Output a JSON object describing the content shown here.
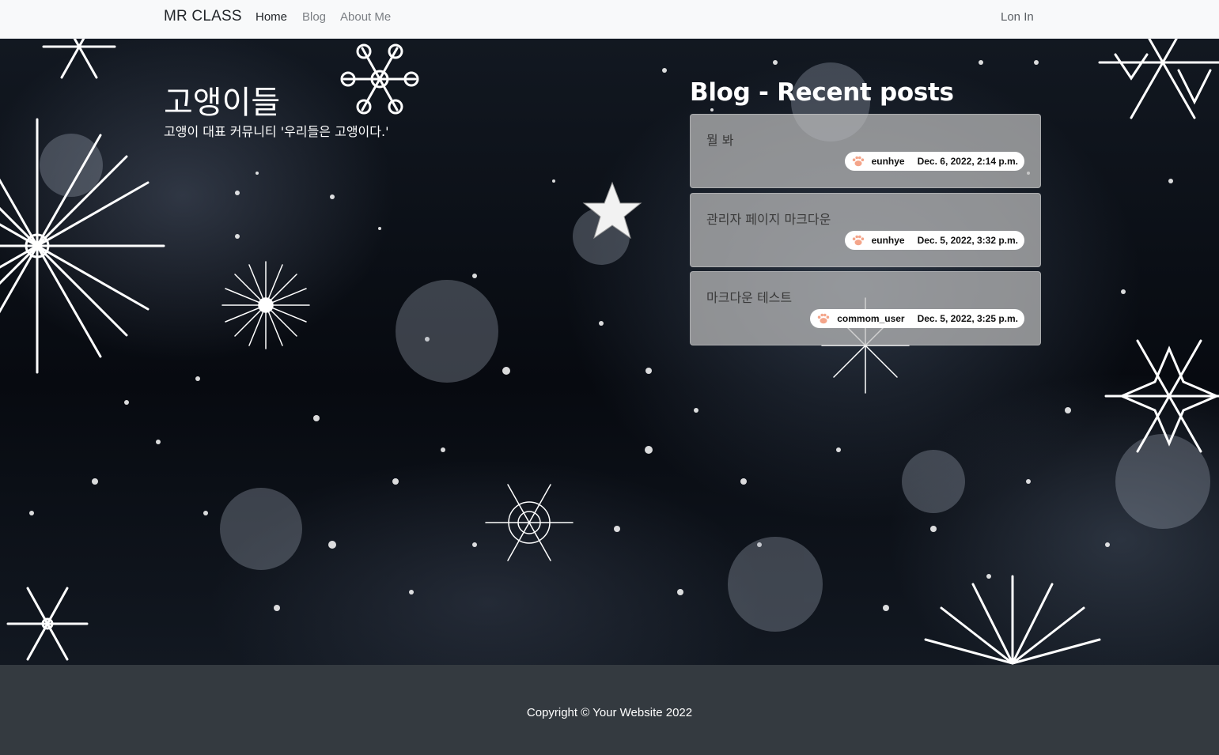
{
  "navbar": {
    "brand": "MR CLASS",
    "links": [
      {
        "label": "Home",
        "active": true
      },
      {
        "label": "Blog",
        "active": false
      },
      {
        "label": "About Me",
        "active": false
      }
    ],
    "login": "Lon In"
  },
  "hero": {
    "title": "고앵이들",
    "subtitle": "고앵이 대표 커뮤니티 '우리들은 고앵이다.'"
  },
  "recent": {
    "heading": "Blog - Recent posts",
    "posts": [
      {
        "title": "뭘 봐",
        "author": "eunhye",
        "date": "Dec. 6, 2022, 2:14 p.m."
      },
      {
        "title": "관리자 페이지 마크다운",
        "author": "eunhye",
        "date": "Dec. 5, 2022, 3:32 p.m."
      },
      {
        "title": "마크다운 테스트",
        "author": "commom_user",
        "date": "Dec. 5, 2022, 3:25 p.m."
      }
    ]
  },
  "footer": {
    "copyright": "Copyright © Your Website 2022"
  },
  "icons": {
    "avatar": "paw-icon",
    "background": "snowflake-icon"
  },
  "colors": {
    "navbar_bg": "#f8f9fa",
    "footer_bg": "#343a40",
    "card_bg": "#bebebe"
  }
}
